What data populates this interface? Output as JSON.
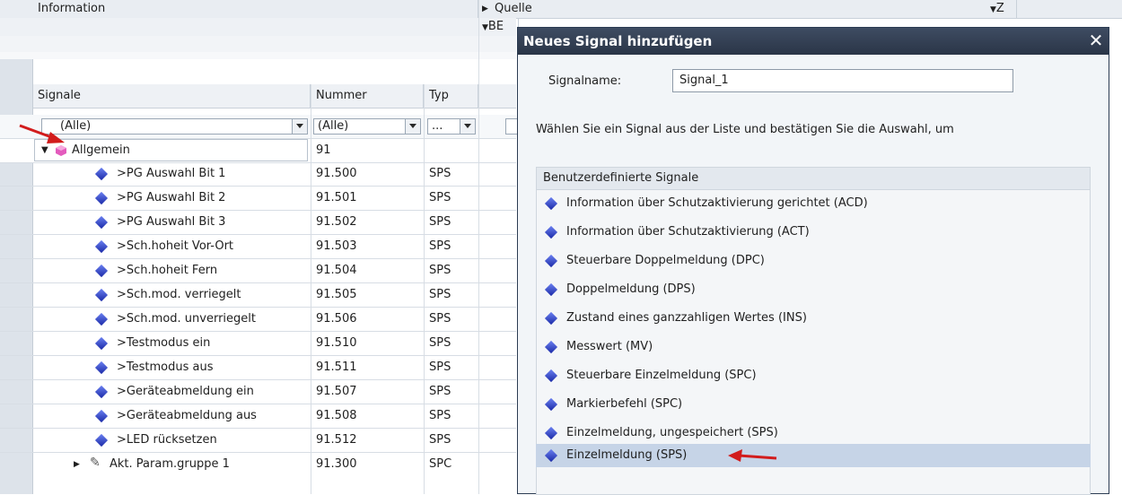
{
  "top_header": {
    "information": "Information",
    "quelle": "Quelle",
    "be": "BE",
    "z": "Z"
  },
  "table": {
    "columns": [
      "Signale",
      "Nummer",
      "Typ"
    ],
    "filters": [
      "(Alle)",
      "(Alle)",
      "..."
    ],
    "group": {
      "name": "Allgemein",
      "number": "91"
    },
    "rows": [
      {
        "name": ">PG Auswahl Bit 1",
        "number": "91.500",
        "type": "SPS"
      },
      {
        "name": ">PG Auswahl Bit 2",
        "number": "91.501",
        "type": "SPS"
      },
      {
        "name": ">PG Auswahl Bit 3",
        "number": "91.502",
        "type": "SPS"
      },
      {
        "name": ">Sch.hoheit Vor-Ort",
        "number": "91.503",
        "type": "SPS"
      },
      {
        "name": ">Sch.hoheit Fern",
        "number": "91.504",
        "type": "SPS"
      },
      {
        "name": ">Sch.mod. verriegelt",
        "number": "91.505",
        "type": "SPS"
      },
      {
        "name": ">Sch.mod. unverriegelt",
        "number": "91.506",
        "type": "SPS"
      },
      {
        "name": ">Testmodus ein",
        "number": "91.510",
        "type": "SPS"
      },
      {
        "name": ">Testmodus aus",
        "number": "91.511",
        "type": "SPS"
      },
      {
        "name": ">Geräteabmeldung ein",
        "number": "91.507",
        "type": "SPS"
      },
      {
        "name": ">Geräteabmeldung aus",
        "number": "91.508",
        "type": "SPS"
      },
      {
        "name": ">LED rücksetzen",
        "number": "91.512",
        "type": "SPS"
      }
    ],
    "last_row": {
      "name": "Akt. Param.gruppe 1",
      "number": "91.300",
      "type": "SPC"
    }
  },
  "dialog": {
    "title": "Neues Signal hinzufügen",
    "signalname_label": "Signalname:",
    "signalname_value": "Signal_1",
    "instruction": "Wählen Sie ein Signal aus der Liste und bestätigen Sie die Auswahl, um",
    "list_header": "Benutzerdefinierte Signale",
    "items": [
      "Information über Schutzaktivierung gerichtet (ACD)",
      "Information über Schutzaktivierung (ACT)",
      "Steuerbare Doppelmeldung (DPC)",
      "Doppelmeldung (DPS)",
      "Zustand eines ganzzahligen Wertes (INS)",
      "Messwert (MV)",
      "Steuerbare Einzelmeldung (SPC)",
      "Markierbefehl (SPC)",
      "Einzelmeldung, ungespeichert (SPS)",
      "Einzelmeldung (SPS)"
    ],
    "selected_index": 9
  },
  "colors": {
    "title_bar": "#2a3547",
    "selection": "#c6d4e7",
    "arrow": "#d21c1c",
    "signal_icon": "#1b2aa8"
  }
}
